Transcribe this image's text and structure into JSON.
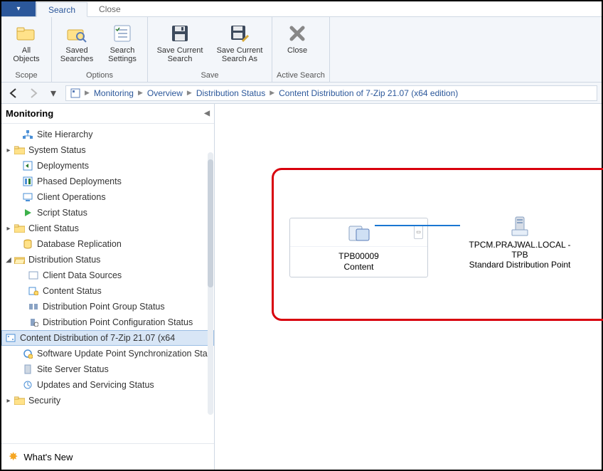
{
  "tabs": {
    "search": "Search",
    "close": "Close"
  },
  "ribbon": {
    "scope_label": "Scope",
    "all_objects": "All\nObjects",
    "options_label": "Options",
    "saved_searches": "Saved\nSearches",
    "search_settings": "Search\nSettings",
    "save_label": "Save",
    "save_current": "Save Current\nSearch",
    "save_current_as": "Save Current\nSearch As",
    "active_label": "Active Search",
    "close": "Close"
  },
  "breadcrumb": {
    "items": [
      "Monitoring",
      "Overview",
      "Distribution Status",
      "Content Distribution of 7-Zip 21.07 (x64 edition)"
    ]
  },
  "sidebar": {
    "title": "Monitoring",
    "items": [
      "Site Hierarchy",
      "System Status",
      "Deployments",
      "Phased Deployments",
      "Client Operations",
      "Script Status",
      "Client Status",
      "Database Replication",
      "Distribution Status",
      "Client Data Sources",
      "Content Status",
      "Distribution Point Group Status",
      "Distribution Point Configuration Status",
      "Content Distribution of 7-Zip 21.07 (x64",
      "Software Update Point Synchronization Sta",
      "Site Server Status",
      "Updates and Servicing Status",
      "Security"
    ],
    "whats_new": "What's New"
  },
  "diagram": {
    "content_id": "TPB00009",
    "content_label": "Content",
    "dp_name": "TPCM.PRAJWAL.LOCAL - TPB",
    "dp_role": "Standard Distribution Point"
  }
}
